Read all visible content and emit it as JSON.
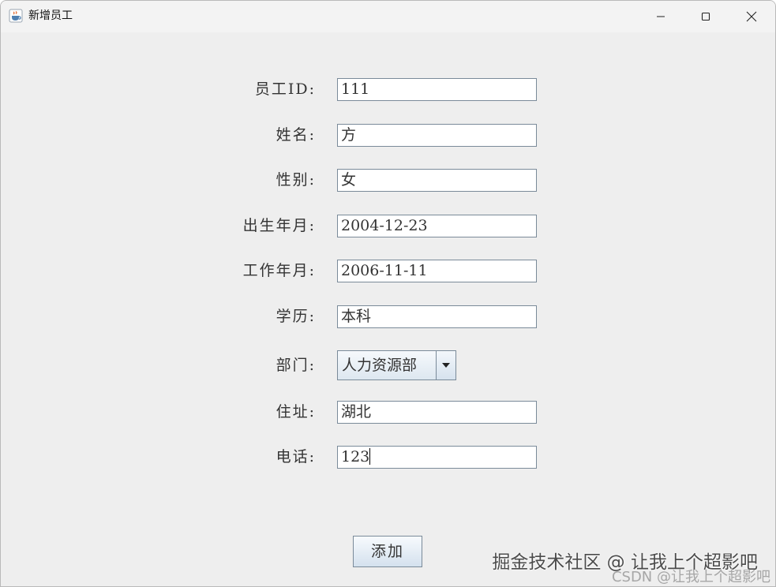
{
  "window": {
    "title": "新增员工"
  },
  "form": {
    "fields": [
      {
        "label": "员工ID:",
        "value": "111"
      },
      {
        "label": "姓名:",
        "value": "方"
      },
      {
        "label": "性别:",
        "value": "女"
      },
      {
        "label": "出生年月:",
        "value": "2004-12-23"
      },
      {
        "label": "工作年月:",
        "value": "2006-11-11"
      },
      {
        "label": "学历:",
        "value": "本科"
      }
    ],
    "department": {
      "label": "部门:",
      "selected": "人力资源部"
    },
    "fields2": [
      {
        "label": "住址:",
        "value": "湖北"
      },
      {
        "label": "电话:",
        "value": "123"
      }
    ],
    "add_label": "添加"
  },
  "watermark": {
    "line1": "掘金技术社区 @ 让我上个超影吧",
    "line2": "CSDN @让我上个超影吧"
  },
  "icons": {
    "app": "java-cup-icon",
    "minimize": "minimize-icon",
    "maximize": "maximize-icon",
    "close": "close-icon",
    "dropdown": "chevron-down-icon"
  }
}
